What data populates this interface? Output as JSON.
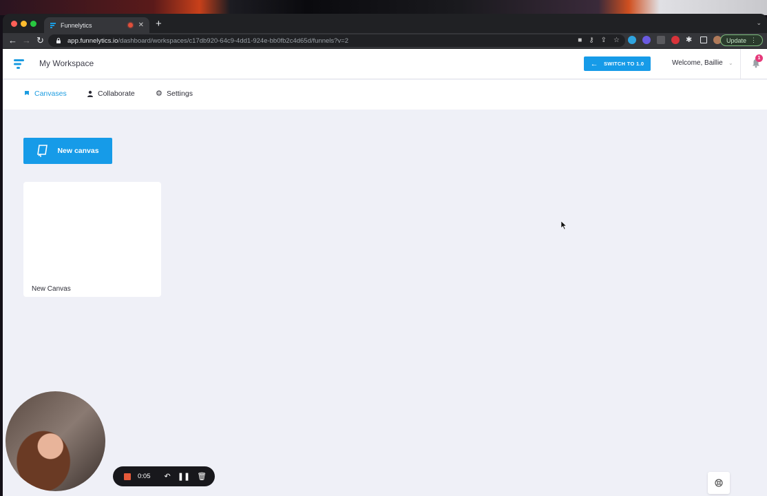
{
  "browser": {
    "tab_title": "Funnelytics",
    "new_tab_icon": "plus-icon",
    "url_host": "app.funnelytics.io",
    "url_path": "/dashboard/workspaces/c17db920-64c9-4dd1-924e-bb0fb2c4d65d/funnels?v=2",
    "update_label": "Update"
  },
  "header": {
    "workspace_title": "My Workspace",
    "switch_label": "SWITCH TO 1.0",
    "welcome_text": "Welcome, Baillie",
    "notification_count": "1"
  },
  "subnav": {
    "items": [
      {
        "label": "Canvases",
        "icon": "canvas-icon",
        "active": true
      },
      {
        "label": "Collaborate",
        "icon": "user-icon",
        "active": false
      },
      {
        "label": "Settings",
        "icon": "gear-icon",
        "active": false
      }
    ]
  },
  "main": {
    "new_canvas_label": "New canvas",
    "canvases": [
      {
        "name": "New Canvas"
      }
    ]
  },
  "recorder": {
    "elapsed": "0:05"
  },
  "colors": {
    "accent": "#169be8",
    "badge": "#e6397a",
    "page_bg": "#eff0f7"
  }
}
